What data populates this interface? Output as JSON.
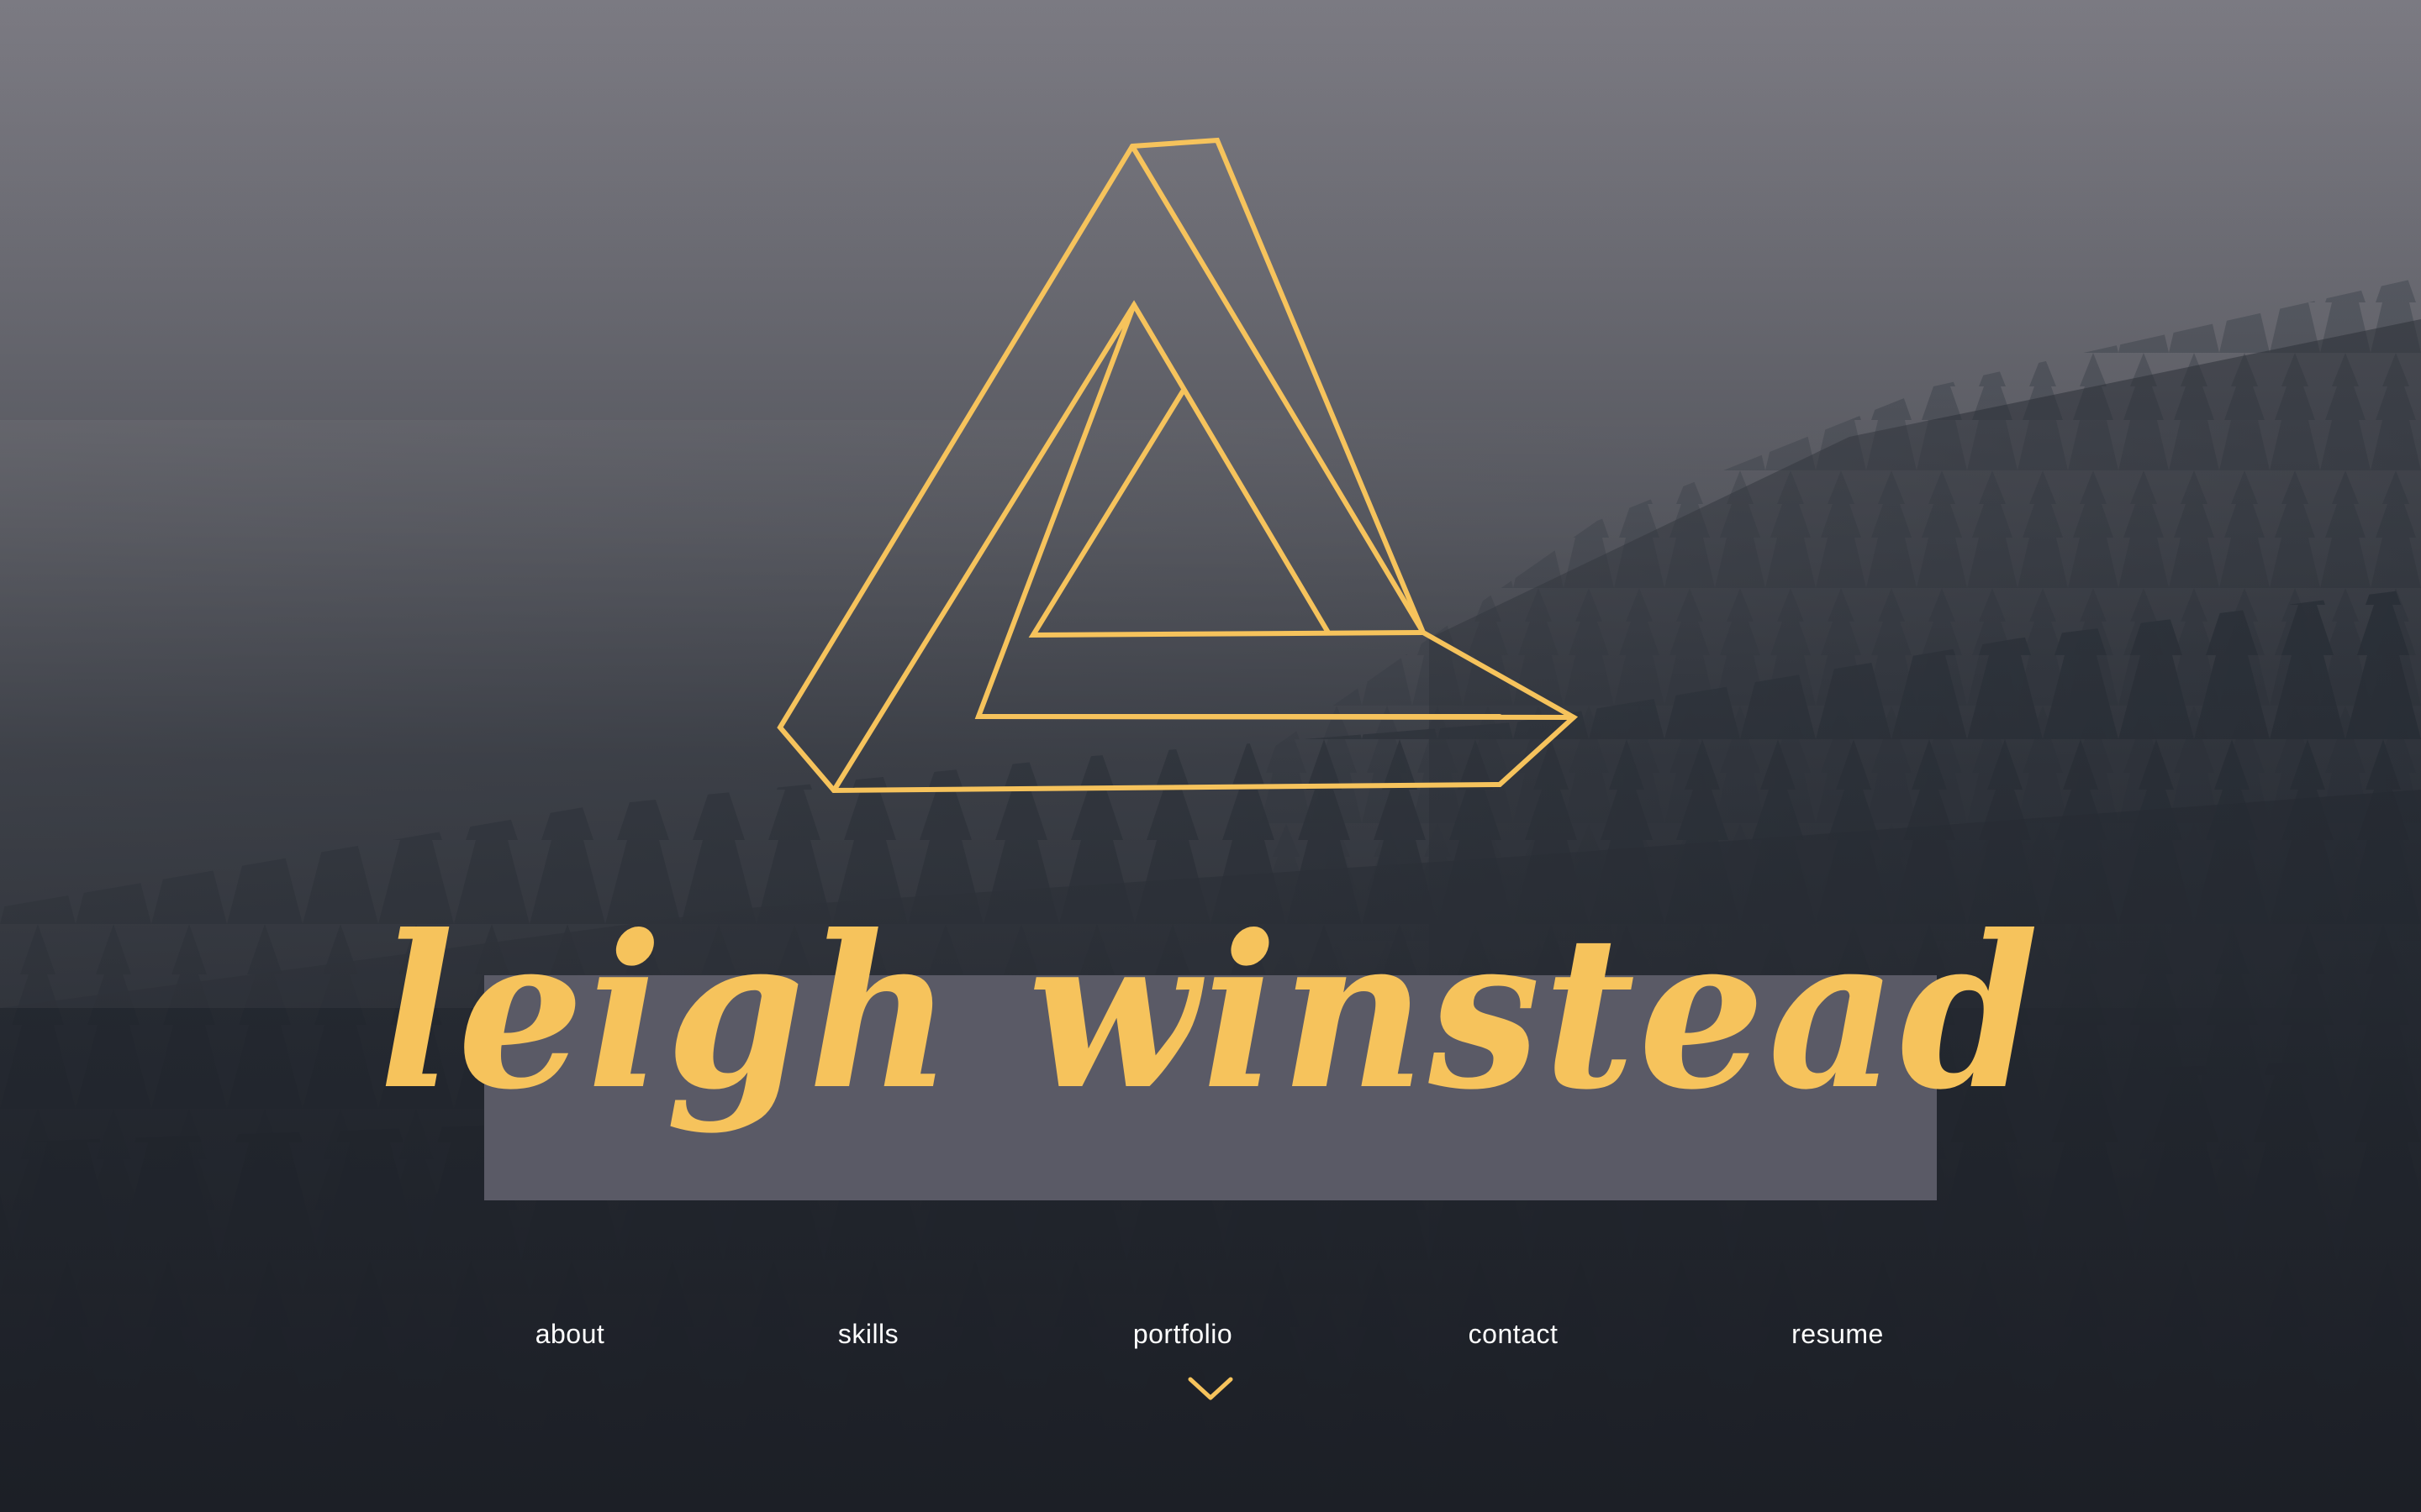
{
  "hero": {
    "name": "leigh winstead",
    "logo_icon": "penrose-triangle-icon",
    "accent_color": "#f6c35c",
    "banner_color": "#5c5c68"
  },
  "nav": {
    "items": [
      {
        "label": "about"
      },
      {
        "label": "skills"
      },
      {
        "label": "portfolio"
      },
      {
        "label": "contact"
      },
      {
        "label": "resume"
      }
    ],
    "scroll_icon": "chevron-down-icon"
  }
}
